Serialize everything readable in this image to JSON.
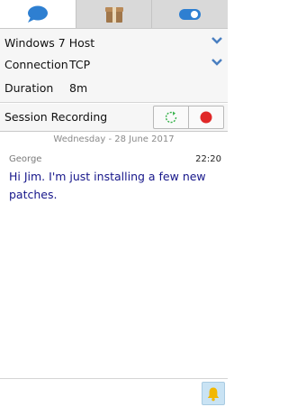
{
  "tabs": [
    {
      "icon": "chat-bubble-icon",
      "active": true
    },
    {
      "icon": "package-icon",
      "active": false
    },
    {
      "icon": "toggle-icon",
      "active": false
    }
  ],
  "info": {
    "host": "Windows 7 Host",
    "connection_label": "Connection",
    "connection_value": "TCP",
    "duration_label": "Duration",
    "duration_value": "8m"
  },
  "recording": {
    "label": "Session Recording",
    "restart_icon": "refresh-icon",
    "record_icon": "record-icon"
  },
  "chat": {
    "date": "Wednesday  -  28 June 2017",
    "messages": [
      {
        "sender": "George",
        "time": "22:20",
        "text": "Hi Jim. I'm just installing a few new patches."
      }
    ]
  },
  "footer": {
    "bell_icon": "bell-icon"
  },
  "colors": {
    "accent": "#2e7fd1",
    "chevron": "#4a7fc1",
    "message_text": "#16168a",
    "record": "#e02828",
    "restart": "#36b24a",
    "bell": "#f2b700"
  }
}
